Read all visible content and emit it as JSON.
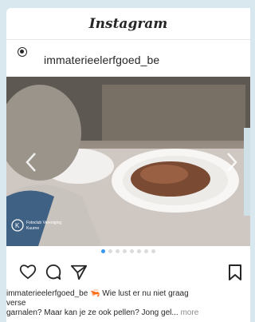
{
  "header": {
    "brand": "Instagram"
  },
  "account": {
    "name": "immaterieelerfgoed_be"
  },
  "post": {
    "caption_user": "immaterieelerfgoed_be",
    "caption_line1": " 🦐 Wie lust er nu niet graag",
    "caption_line2": "verse",
    "caption_line3": "garnalen? Maar kan je ze ook pellen? Jong gel...",
    "more_label": " more",
    "watermark_line1": "Fotoclub Vereniging",
    "watermark_line2": "Kuurne"
  },
  "carousel": {
    "dot_count": 8,
    "active_index": 0
  },
  "icons": {
    "like": "heart-icon",
    "comment": "comment-icon",
    "share": "send-icon",
    "save": "bookmark-icon",
    "prev": "chevron-left-icon",
    "next": "chevron-right-icon"
  },
  "colors": {
    "accent": "#3897f0",
    "text": "#262626",
    "muted": "#8e8e8e"
  }
}
